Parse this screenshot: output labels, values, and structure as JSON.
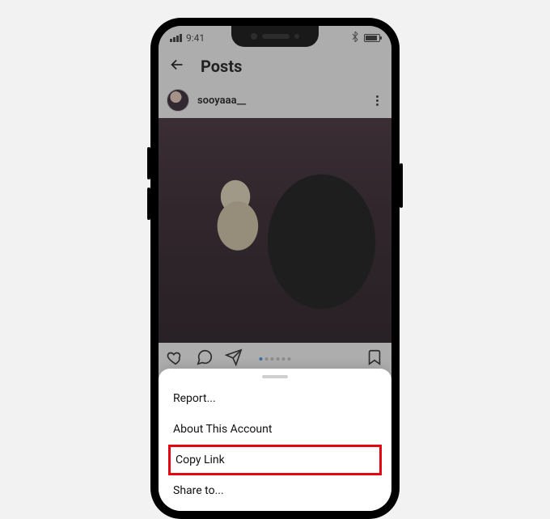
{
  "statusbar": {
    "time": "9:41"
  },
  "header": {
    "title": "Posts"
  },
  "post": {
    "username": "sooyaaa__"
  },
  "carousel": {
    "total": 6,
    "active_index": 0
  },
  "sheet": {
    "items": [
      {
        "label": "Report...",
        "highlight": false
      },
      {
        "label": "About This Account",
        "highlight": false
      },
      {
        "label": "Copy Link",
        "highlight": true
      },
      {
        "label": "Share to...",
        "highlight": false
      }
    ]
  }
}
